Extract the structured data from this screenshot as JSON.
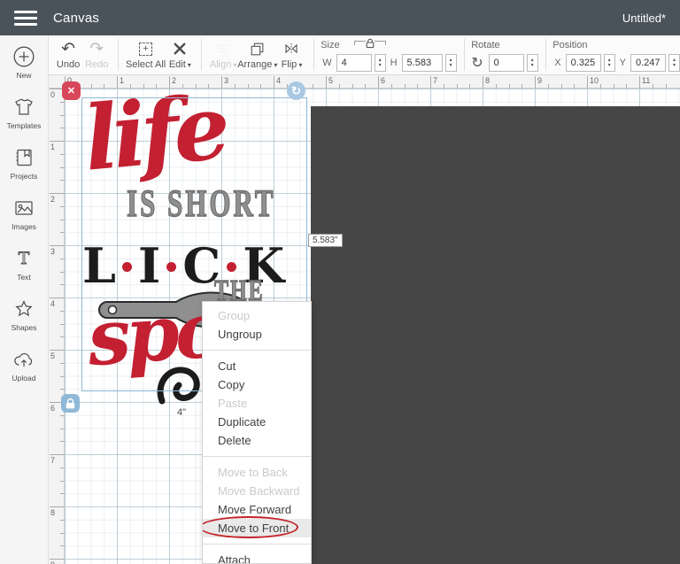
{
  "header": {
    "title": "Canvas",
    "document_name": "Untitled*"
  },
  "toolbar": {
    "undo_label": "Undo",
    "redo_label": "Redo",
    "select_all_label": "Select All",
    "edit_label": "Edit",
    "align_label": "Align",
    "arrange_label": "Arrange",
    "flip_label": "Flip",
    "size": {
      "label": "Size",
      "w_label": "W",
      "w_value": "4",
      "h_label": "H",
      "h_value": "5.583"
    },
    "rotate": {
      "label": "Rotate",
      "value": "0"
    },
    "position": {
      "label": "Position",
      "x_label": "X",
      "x_value": "0.325",
      "y_label": "Y",
      "y_value": "0.247"
    }
  },
  "sidebar": {
    "items": [
      {
        "label": "New",
        "icon": "plus-circle-icon"
      },
      {
        "label": "Templates",
        "icon": "tshirt-icon"
      },
      {
        "label": "Projects",
        "icon": "book-icon"
      },
      {
        "label": "Images",
        "icon": "photo-icon"
      },
      {
        "label": "Text",
        "icon": "text-icon"
      },
      {
        "label": "Shapes",
        "icon": "star-icon"
      },
      {
        "label": "Upload",
        "icon": "cloud-upload-icon"
      }
    ]
  },
  "canvas": {
    "ruler_h": [
      "0",
      "1",
      "2",
      "3",
      "4",
      "5",
      "6",
      "7",
      "8",
      "9",
      "10",
      "11"
    ],
    "ruler_v": [
      "0",
      "1",
      "2",
      "3",
      "4",
      "5",
      "6",
      "7",
      "8",
      "9"
    ],
    "selection": {
      "width_label": "4\"",
      "height_label": "5.583\""
    },
    "design": {
      "word_life": "life",
      "words_is_short": "IS SHORT",
      "lick_letters": [
        "L",
        "I",
        "C",
        "K"
      ],
      "word_the": "THE",
      "word_spoon": "spo"
    }
  },
  "context_menu": {
    "items": [
      {
        "label": "Group",
        "state": "disabled"
      },
      {
        "label": "Ungroup",
        "state": "normal"
      },
      {
        "divider": true
      },
      {
        "label": "Cut",
        "state": "normal"
      },
      {
        "label": "Copy",
        "state": "normal"
      },
      {
        "label": "Paste",
        "state": "disabled"
      },
      {
        "label": "Duplicate",
        "state": "normal"
      },
      {
        "label": "Delete",
        "state": "normal"
      },
      {
        "divider": true
      },
      {
        "label": "Move to Back",
        "state": "disabled"
      },
      {
        "label": "Move Backward",
        "state": "disabled"
      },
      {
        "label": "Move Forward",
        "state": "normal"
      },
      {
        "label": "Move to Front",
        "state": "highlighted",
        "annotated": true
      },
      {
        "divider": true
      },
      {
        "label": "Attach",
        "state": "normal"
      }
    ]
  },
  "colors": {
    "topbar_bg": "#4a535a",
    "design_red": "#c32032",
    "design_gray": "#8f8f8f",
    "design_black": "#1c1c1c",
    "annotation_red": "#c4242b",
    "selection_blue": "#8fb9d6",
    "offcanvas_dark": "#464646"
  }
}
